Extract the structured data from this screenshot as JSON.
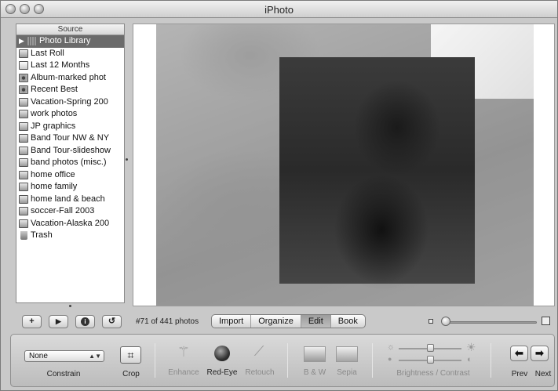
{
  "window": {
    "title": "iPhoto"
  },
  "sidebar": {
    "header": "Source",
    "items": [
      {
        "label": "Photo Library",
        "icon": "library-icon",
        "selected": true
      },
      {
        "label": "Last Roll",
        "icon": "film-roll-icon"
      },
      {
        "label": "Last 12 Months",
        "icon": "calendar-icon"
      },
      {
        "label": "Album-marked phot",
        "icon": "smart-album-icon"
      },
      {
        "label": "Recent Best",
        "icon": "smart-album-icon"
      },
      {
        "label": "Vacation-Spring 200",
        "icon": "album-icon"
      },
      {
        "label": "work photos",
        "icon": "album-icon"
      },
      {
        "label": "JP graphics",
        "icon": "album-icon"
      },
      {
        "label": "Band Tour NW & NY",
        "icon": "album-icon"
      },
      {
        "label": "Band Tour-slideshow",
        "icon": "album-icon"
      },
      {
        "label": "band photos (misc.)",
        "icon": "album-icon"
      },
      {
        "label": "home office",
        "icon": "album-icon"
      },
      {
        "label": "home family",
        "icon": "album-icon"
      },
      {
        "label": "home land & beach",
        "icon": "album-icon"
      },
      {
        "label": "soccer-Fall 2003",
        "icon": "album-icon"
      },
      {
        "label": "Vacation-Alaska 200",
        "icon": "album-icon"
      },
      {
        "label": "Trash",
        "icon": "trash-icon"
      }
    ]
  },
  "toolbar": {
    "add_label": "+",
    "play_label": "▶",
    "info_label": "i",
    "rotate_label": "↺",
    "photo_count": "#71 of 441 photos",
    "modes": [
      {
        "label": "Import",
        "active": false
      },
      {
        "label": "Organize",
        "active": false
      },
      {
        "label": "Edit",
        "active": true
      },
      {
        "label": "Book",
        "active": false
      }
    ],
    "zoom_level": 0.0
  },
  "edit": {
    "constrain_value": "None",
    "constrain_label": "Constrain",
    "crop_label": "Crop",
    "enhance_label": "Enhance",
    "redeye_label": "Red-Eye",
    "retouch_label": "Retouch",
    "bw_label": "B & W",
    "sepia_label": "Sepia",
    "brightness_contrast_label": "Brightness / Contrast",
    "prev_label": "Prev",
    "next_label": "Next"
  },
  "colors": {
    "selected_row": "#6b6b6b",
    "panel": "#c9c9c9"
  }
}
